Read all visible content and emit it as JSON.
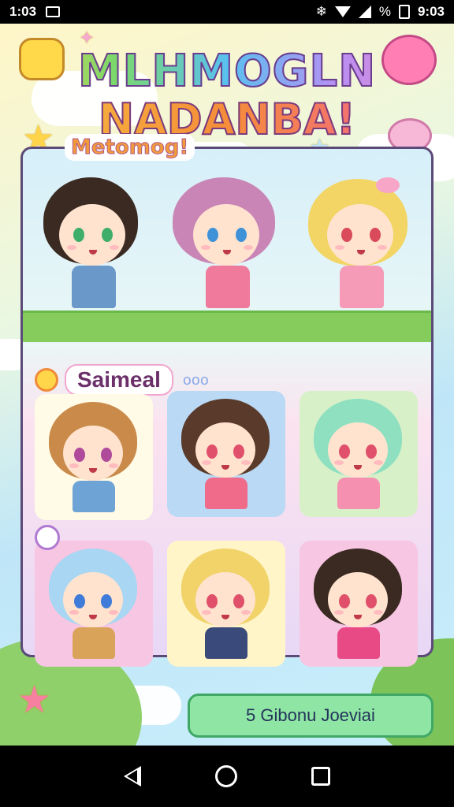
{
  "status": {
    "time_left": "1:03",
    "time_right": "9:03",
    "battery": "%"
  },
  "title": {
    "line1": "MLHMOGLN",
    "line2": "NADANBA!"
  },
  "group_label": "Metomog!",
  "section_label": "Saimeal",
  "section_dots": "ooo",
  "cta_label": "5 Gibonu Joeviai",
  "colors": {
    "panel_border": "#5b4a78",
    "cta_bg": "#8fe6a4",
    "cta_border": "#3fa867",
    "grass": "#86cc5d"
  },
  "top_characters": [
    {
      "hair": "#3a2a22",
      "eyes": "#3fae6a",
      "outfit": "#6a98c8"
    },
    {
      "hair": "#c985b6",
      "eyes": "#3f92d8",
      "outfit": "#f07a9c"
    },
    {
      "hair": "#f3d565",
      "eyes": "#d94a5a",
      "outfit": "#f59bb8"
    }
  ],
  "cards": [
    {
      "bg": "#fffbe6",
      "hair": "#c98a4a",
      "eyes": "#b04a9a",
      "outfit": "#6ea3d6"
    },
    {
      "bg": "#b9d9f5",
      "hair": "#5a3a2a",
      "eyes": "#e0506a",
      "outfit": "#f06a8a"
    },
    {
      "bg": "#d8f0c8",
      "hair": "#8fe0c0",
      "eyes": "#e0506a",
      "outfit": "#f590b0"
    },
    {
      "bg": "#f7c6e2",
      "hair": "#a9d6f2",
      "eyes": "#3f7bd8",
      "outfit": "#d9a45a"
    },
    {
      "bg": "#fff5c8",
      "hair": "#f2d36a",
      "eyes": "#e0506a",
      "outfit": "#3a4a7a"
    },
    {
      "bg": "#f7c6e2",
      "hair": "#3a2a22",
      "eyes": "#e0506a",
      "outfit": "#e84a86"
    }
  ]
}
